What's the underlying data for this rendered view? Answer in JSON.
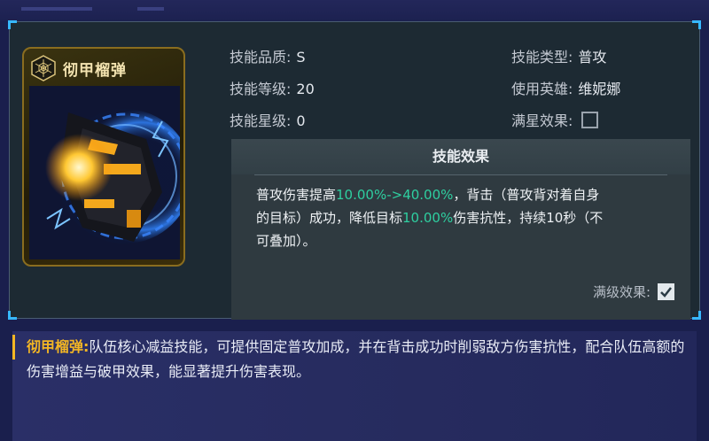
{
  "card": {
    "title": "彻甲榴弹"
  },
  "attributes": {
    "quality_label": "技能品质:",
    "quality_value": "S",
    "level_label": "技能等级:",
    "level_value": "20",
    "star_label": "技能星级:",
    "star_value": "0",
    "type_label": "技能类型:",
    "type_value": "普攻",
    "hero_label": "使用英雄:",
    "hero_value": "维妮娜",
    "full_star_label": "满星效果:"
  },
  "effect": {
    "header": "技能效果",
    "line1_a": "普攻伤害提高",
    "line1_hl": "10.00%->40.00%",
    "line1_b": "，背击（普攻背对着自身",
    "line2_a": "的目标）成功，降低目标",
    "line2_hl": "10.00%",
    "line2_b": "伤害抗性，持续10秒（不",
    "line3": "可叠加）。",
    "full_level_label": "满级效果:"
  },
  "description": {
    "title": "彻甲榴弹:",
    "text": "队伍核心减益技能，可提供固定普攻加成，并在背击成功时削弱敌方伤害抗性，配合队伍高额的伤害增益与破甲效果，能显著提升伤害表现。"
  },
  "colors": {
    "highlight": "#2ecfa0",
    "accent_gold": "#f3b624",
    "panel_border": "#37b8ff"
  },
  "icons": {
    "emblem": "hexagon-web-emblem-icon",
    "checked": "check-icon"
  }
}
